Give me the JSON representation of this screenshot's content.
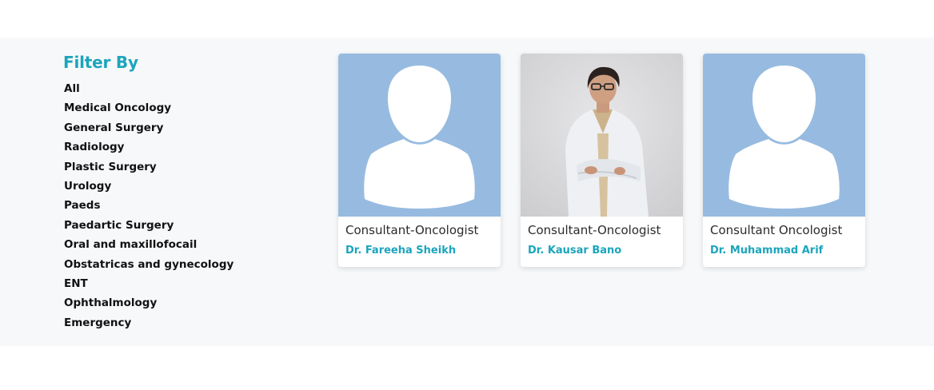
{
  "filter": {
    "title": "Filter By",
    "items": [
      "All",
      "Medical Oncology",
      "General Surgery",
      "Radiology",
      "Plastic Surgery",
      "Urology",
      "Paeds",
      "Paedartic Surgery",
      "Oral and maxillofocail",
      "Obstatricas and gynecology",
      "ENT",
      "Ophthalmology",
      "Emergency"
    ]
  },
  "doctors": [
    {
      "role": "Consultant-Oncologist",
      "name": "Dr. Fareeha Sheikh",
      "photo": "placeholder-avatar"
    },
    {
      "role": "Consultant-Oncologist",
      "name": "Dr. Kausar Bano",
      "photo": "doctor-portrait"
    },
    {
      "role": "Consultant Oncologist",
      "name": "Dr. Muhammad Arif",
      "photo": "placeholder-avatar"
    }
  ],
  "colors": {
    "accent": "#1ba5bd",
    "placeholder_bg": "#97bbe0",
    "band_bg": "#f7f8fa"
  }
}
